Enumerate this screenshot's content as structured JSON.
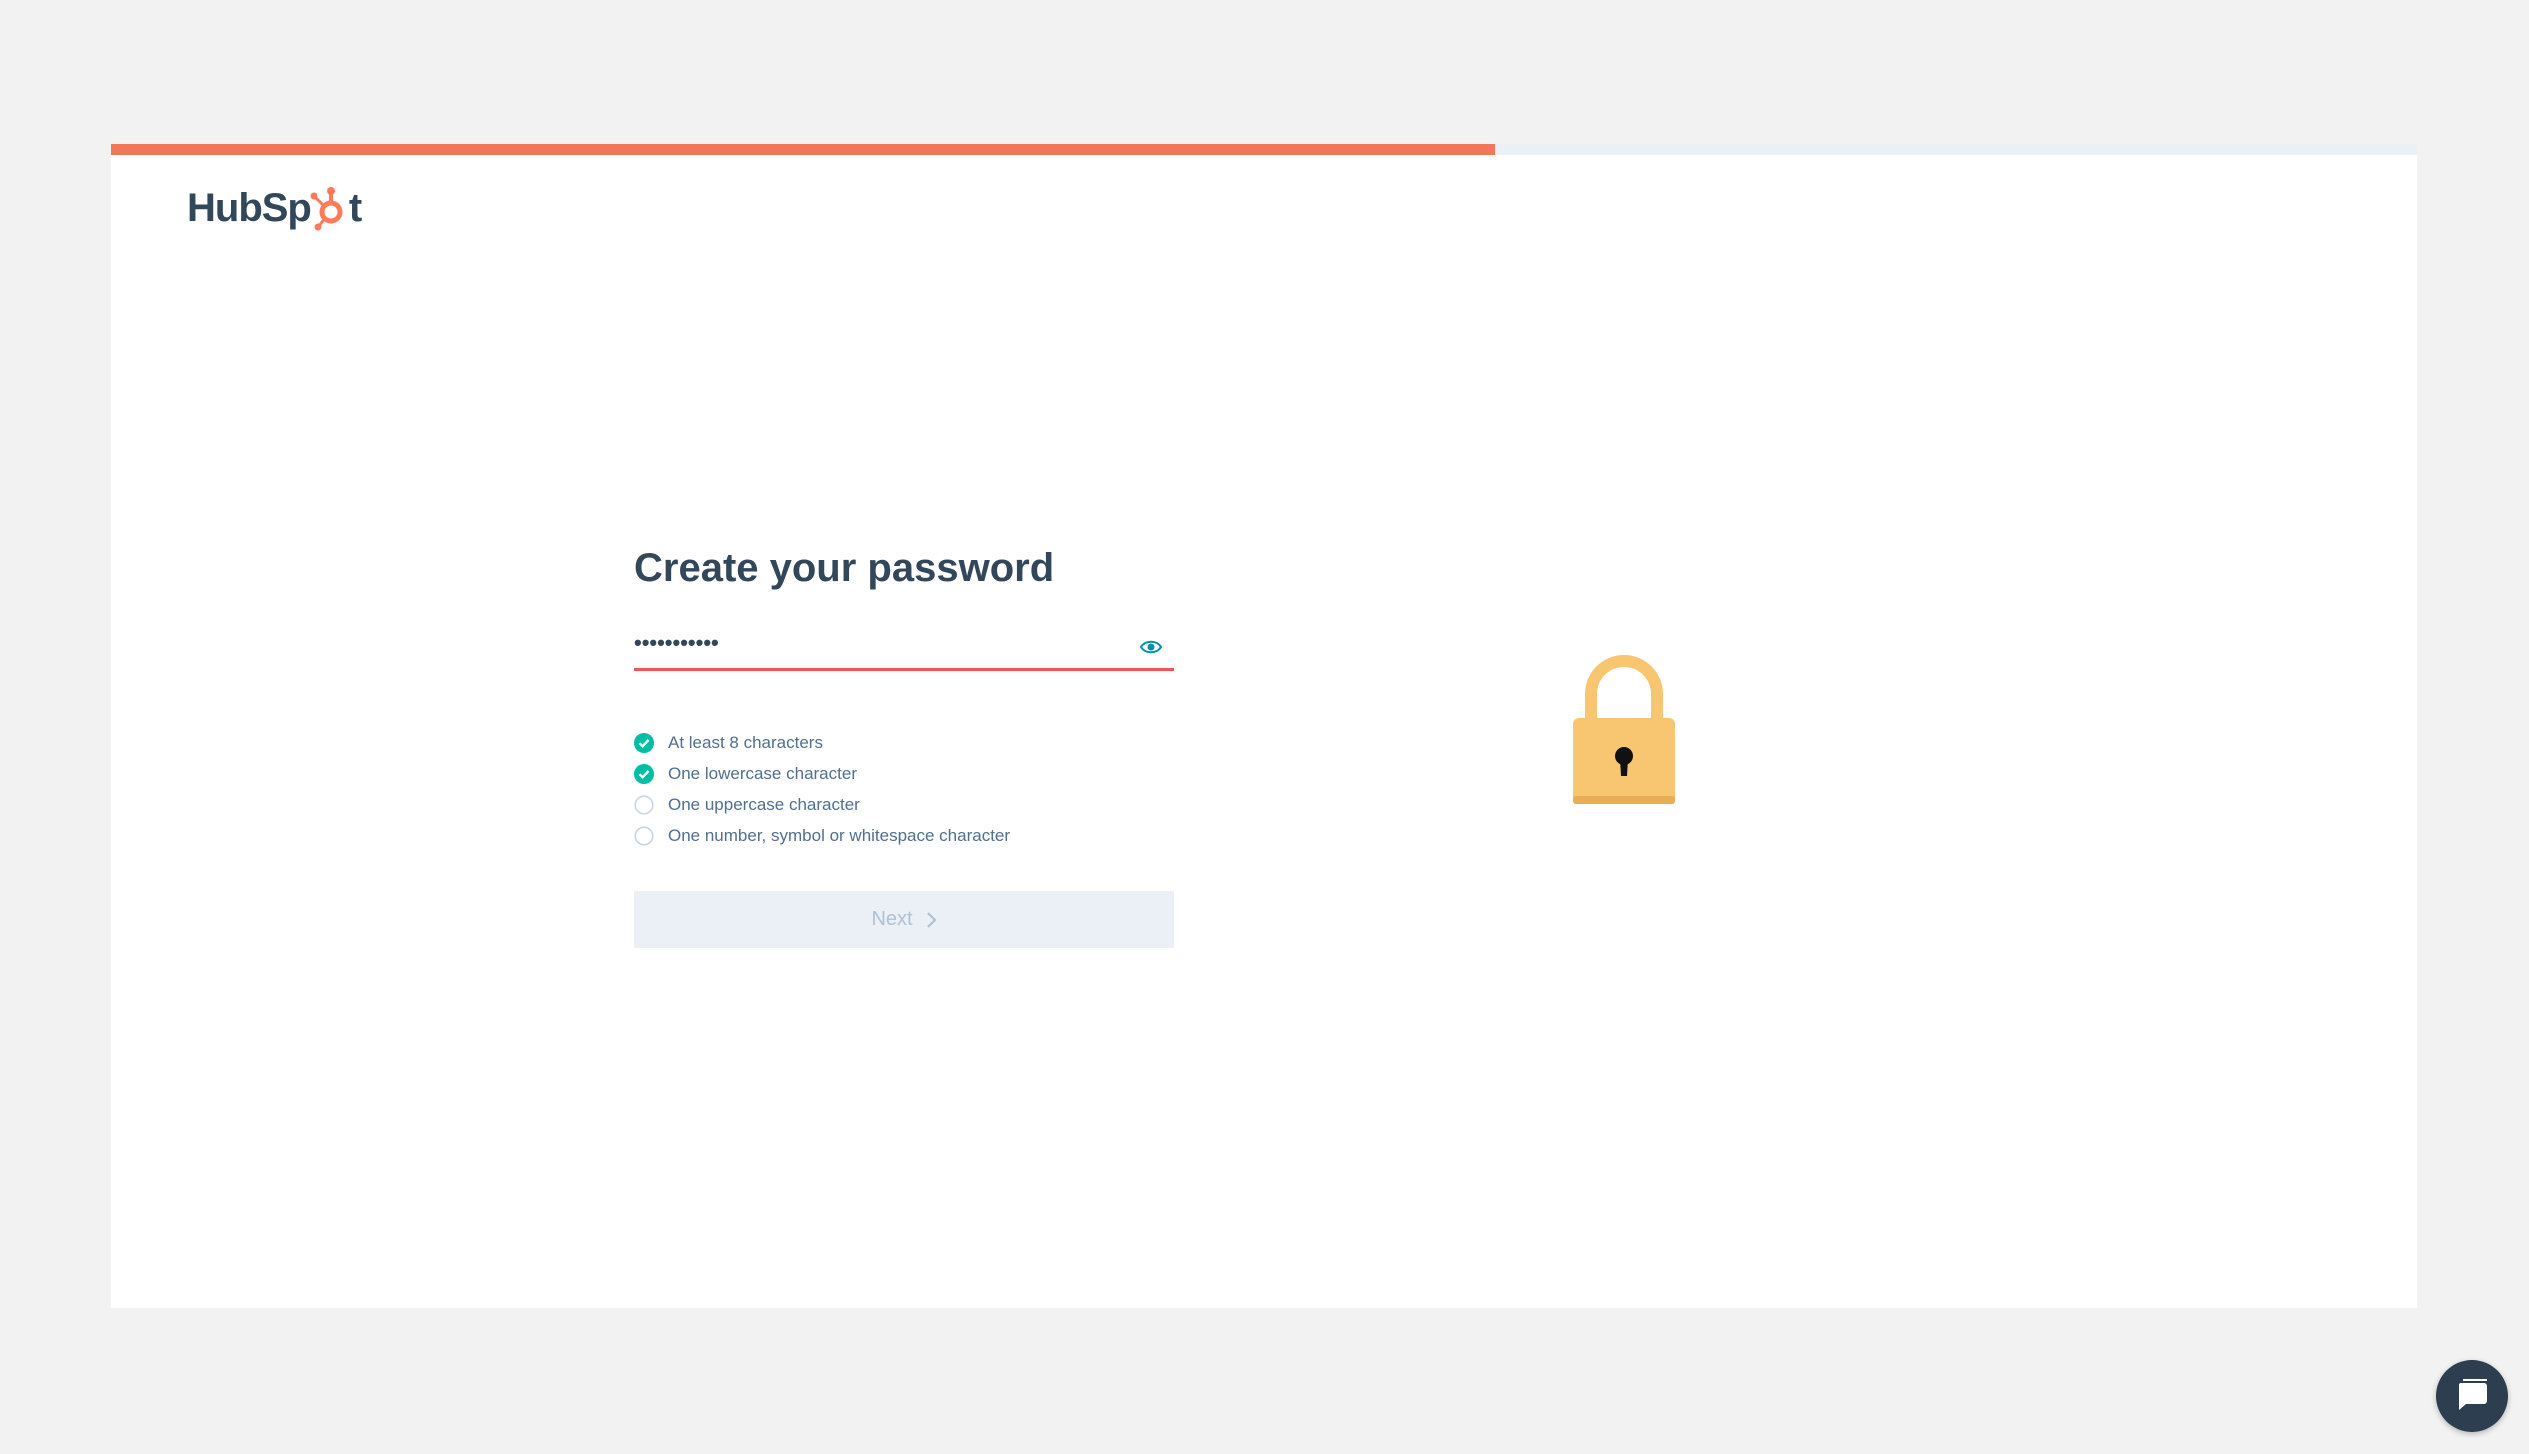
{
  "app": {
    "brand": {
      "logo_left": "HubSp",
      "logo_right": "t"
    }
  },
  "progress": {
    "fraction": 0.6,
    "color": "#f0775a"
  },
  "form": {
    "title": "Create your password",
    "password_masked": "•••••••••••",
    "show_password_icon": "eye-icon",
    "rules": [
      {
        "label": "At least 8 characters",
        "met": true
      },
      {
        "label": "One lowercase character",
        "met": true
      },
      {
        "label": "One uppercase character",
        "met": false
      },
      {
        "label": "One number, symbol or whitespace character",
        "met": false
      }
    ],
    "next_label": "Next",
    "next_icon": "chevron-right-icon"
  },
  "illustration": {
    "icon": "padlock-icon",
    "color": "#f8c571"
  },
  "chat": {
    "icon": "chat-icon",
    "color": "#2d3e50"
  },
  "colors": {
    "heading": "#33475b",
    "rule_met": "#00bda5",
    "rule_unmet": "#cbd6e2",
    "error_underline": "#f2545b",
    "accent": "#f0775a"
  }
}
